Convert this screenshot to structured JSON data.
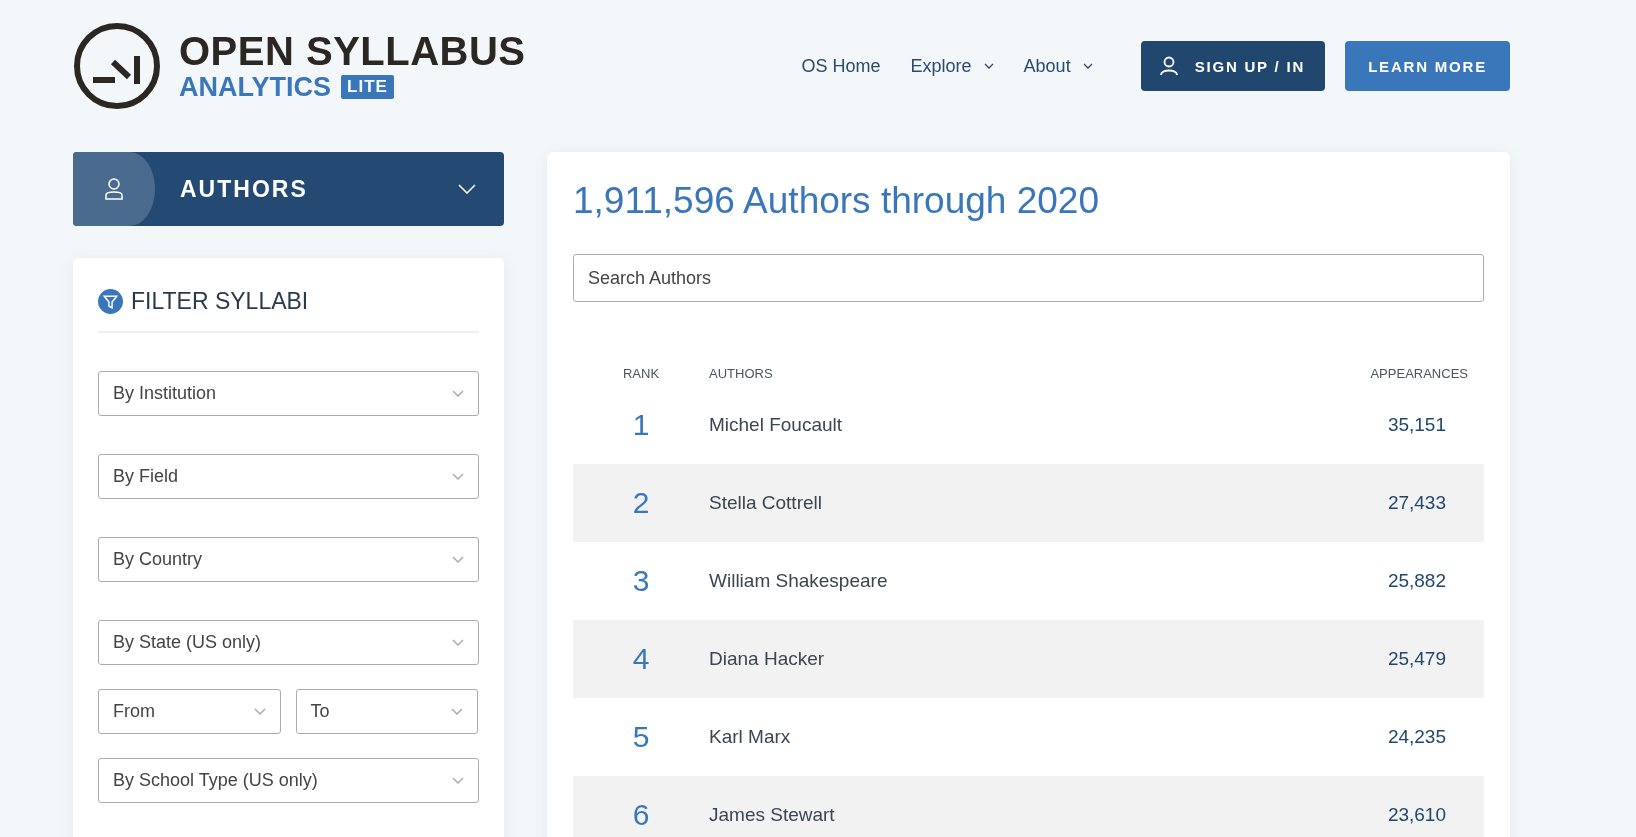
{
  "logo": {
    "line1": "OPEN SYLLABUS",
    "line2": "ANALYTICS",
    "badge": "LITE"
  },
  "nav": {
    "links": [
      {
        "label": "OS Home",
        "dropdown": false
      },
      {
        "label": "Explore",
        "dropdown": true
      },
      {
        "label": "About",
        "dropdown": true
      }
    ],
    "sign_in": "SIGN UP / IN",
    "learn_more": "LEARN MORE"
  },
  "category": {
    "label": "AUTHORS"
  },
  "filters": {
    "title": "FILTER SYLLABI",
    "selects": [
      {
        "placeholder": "By Institution",
        "kind": "full"
      },
      {
        "placeholder": "By Field",
        "kind": "full"
      },
      {
        "placeholder": "By Country",
        "kind": "full"
      },
      {
        "placeholder": "By State (US only)",
        "kind": "full"
      },
      {
        "placeholder": "From",
        "kind": "half"
      },
      {
        "placeholder": "To",
        "kind": "half"
      },
      {
        "placeholder": "By School Type (US only)",
        "kind": "full"
      }
    ]
  },
  "main": {
    "title": "1,911,596 Authors through 2020",
    "search": {
      "placeholder": "Search Authors"
    },
    "table": {
      "columns": [
        "RANK",
        "AUTHORS",
        "APPEARANCES"
      ],
      "rows": [
        {
          "rank": "1",
          "author": "Michel Foucault",
          "appearances": "35,151"
        },
        {
          "rank": "2",
          "author": "Stella Cottrell",
          "appearances": "27,433"
        },
        {
          "rank": "3",
          "author": "William Shakespeare",
          "appearances": "25,882"
        },
        {
          "rank": "4",
          "author": "Diana Hacker",
          "appearances": "25,479"
        },
        {
          "rank": "5",
          "author": "Karl Marx",
          "appearances": "24,235"
        },
        {
          "rank": "6",
          "author": "James Stewart",
          "appearances": "23,610"
        }
      ]
    }
  }
}
